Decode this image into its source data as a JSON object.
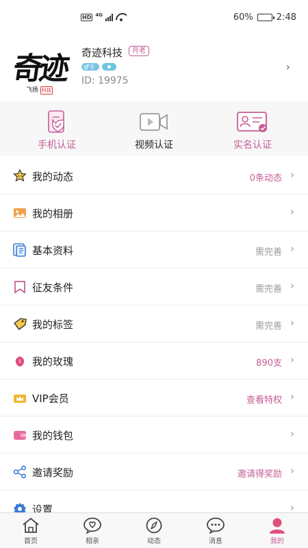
{
  "status_bar": {
    "hd": "HD",
    "network": "4G",
    "battery_percent": "60%",
    "battery_level": 0.6,
    "time": "2:48"
  },
  "profile": {
    "avatar_calligraphy": "奇迹",
    "avatar_subtext": "飞扬",
    "avatar_seal": "科技",
    "name": "奇迹科技",
    "tag": "月老",
    "gender_badge": "0",
    "user_id": "ID: 19975",
    "arrow": "›"
  },
  "verification": [
    {
      "label": "手机认证",
      "icon": "phone-verified-icon",
      "color": "#c55c95"
    },
    {
      "label": "视频认证",
      "icon": "video-camera-icon",
      "color": "#999999"
    },
    {
      "label": "实名认证",
      "icon": "id-card-verified-icon",
      "color": "#c55c95"
    }
  ],
  "menu": [
    {
      "label": "我的动态",
      "value": "0条动态",
      "value_style": "pink",
      "icon": "moments-icon"
    },
    {
      "label": "我的相册",
      "value": "",
      "value_style": "grey",
      "icon": "photo-album-icon"
    },
    {
      "label": "基本资料",
      "value": "需完善",
      "value_style": "grey",
      "icon": "profile-info-icon"
    },
    {
      "label": "征友条件",
      "value": "需完善",
      "value_style": "grey",
      "icon": "bookmark-icon"
    },
    {
      "label": "我的标签",
      "value": "需完善",
      "value_style": "grey",
      "icon": "tag-icon"
    },
    {
      "label": "我的玫瑰",
      "value": "890支",
      "value_style": "pink",
      "icon": "rose-icon"
    },
    {
      "label": "VIP会员",
      "value": "查看特权",
      "value_style": "pink",
      "icon": "vip-crown-icon"
    },
    {
      "label": "我的钱包",
      "value": "",
      "value_style": "grey",
      "icon": "wallet-icon"
    },
    {
      "label": "邀请奖励",
      "value": "邀请得奖励",
      "value_style": "pink",
      "icon": "share-icon"
    },
    {
      "label": "设置",
      "value": "",
      "value_style": "grey",
      "icon": "gear-icon"
    }
  ],
  "menu_arrow": "›",
  "tabs": [
    {
      "label": "首页",
      "icon": "home-icon",
      "active": false
    },
    {
      "label": "相亲",
      "icon": "heart-chat-icon",
      "active": false
    },
    {
      "label": "动态",
      "icon": "compass-icon",
      "active": false
    },
    {
      "label": "消息",
      "icon": "message-icon",
      "active": false
    },
    {
      "label": "我的",
      "icon": "profile-person-icon",
      "active": true
    }
  ],
  "colors": {
    "accent": "#c55c95",
    "grey_text": "#999999",
    "band_bg": "#f7f7f7"
  }
}
